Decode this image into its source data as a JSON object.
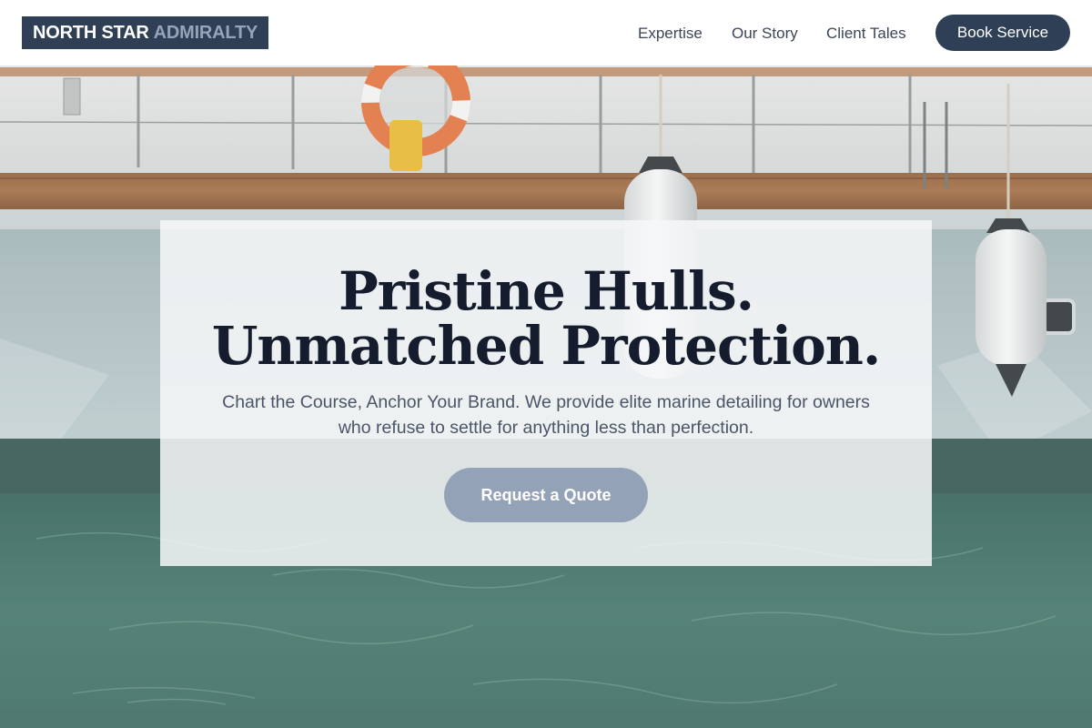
{
  "brand": {
    "name_primary": "NORTH STAR",
    "name_secondary": "ADMIRALTY"
  },
  "nav": {
    "items": [
      {
        "label": "Expertise"
      },
      {
        "label": "Our Story"
      },
      {
        "label": "Client Tales"
      }
    ],
    "cta_label": "Book Service"
  },
  "hero": {
    "headline_line1": "Pristine Hulls.",
    "headline_line2": "Unmatched Protection.",
    "subtext": "Chart the Course, Anchor Your Brand. We provide elite marine detailing for owners who refuse to settle for anything less than perfection.",
    "cta_label": "Request a Quote"
  },
  "colors": {
    "brand_navy": "#2f3f56",
    "brand_muted": "#97a4b8",
    "headline": "#141c2e",
    "quote_button": "#94a2b8",
    "water": "#3d6e63",
    "teak": "#8a5a36"
  }
}
